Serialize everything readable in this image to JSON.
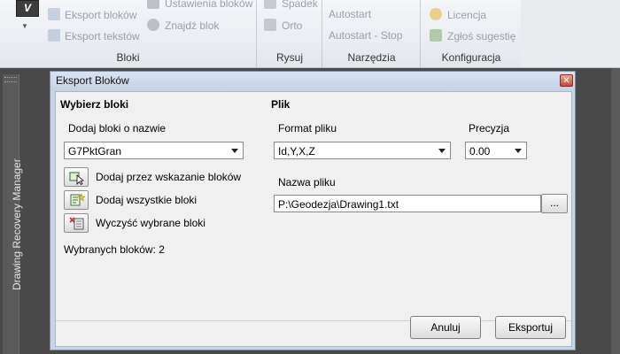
{
  "ribbon": {
    "app_button": "V",
    "left_items": [
      "Eksport bloków",
      "Eksport tekstów"
    ],
    "mid_items": [
      "Ustawienia bloków",
      "Znajdź blok"
    ],
    "rysuj_items": [
      "Spadek",
      "Orto"
    ],
    "narzedzia_items": [
      "Autostart",
      "Autostart - Stop"
    ],
    "konfiguracja_items": [
      "Licencja",
      "Zgłoś sugestię"
    ],
    "groups": [
      "Bloki",
      "Rysuj",
      "Narzędzia",
      "Konfiguracja"
    ]
  },
  "side_panel": {
    "label": "Drawing Recovery Manager"
  },
  "dialog": {
    "title": "Eksport Bloków",
    "close_symbol": "✕",
    "left": {
      "heading": "Wybierz bloki",
      "name_label": "Dodaj bloki o nazwie",
      "name_value": "G7PktGran",
      "actions": [
        "Dodaj przez wskazanie bloków",
        "Dodaj wszystkie bloki",
        "Wyczyść wybrane bloki"
      ],
      "selected_count": "Wybranych bloków: 2"
    },
    "right": {
      "heading": "Plik",
      "format_label": "Format pliku",
      "format_value": "Id,Y,X,Z",
      "precision_label": "Precyzja",
      "precision_value": "0.00",
      "filename_label": "Nazwa pliku",
      "filename_value": "P:\\Geodezja\\Drawing1.txt",
      "browse_label": "..."
    },
    "buttons": {
      "cancel": "Anuluj",
      "export": "Eksportuj"
    }
  },
  "colors": {
    "dialog_frame": "#c7d6e6",
    "client_bg": "#f0f0f0",
    "close_red": "#c44b34"
  }
}
